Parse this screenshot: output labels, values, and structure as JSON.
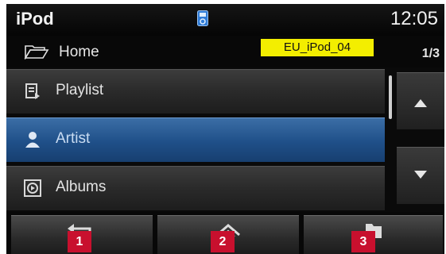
{
  "status": {
    "app_title": "iPod",
    "clock": "12:05"
  },
  "crumb": {
    "label": "Home",
    "tag": "EU_iPod_04",
    "page": "1/3"
  },
  "list": {
    "items": [
      {
        "label": "Playlist",
        "icon": "playlist-icon",
        "selected": false
      },
      {
        "label": "Artist",
        "icon": "artist-icon",
        "selected": true
      },
      {
        "label": "Albums",
        "icon": "album-icon",
        "selected": false
      }
    ]
  },
  "scroll": {
    "up": "scroll-up-icon",
    "down": "scroll-down-icon"
  },
  "bottom": {
    "buttons": [
      {
        "icon": "back-icon",
        "number": "1"
      },
      {
        "icon": "home-icon",
        "number": "2"
      },
      {
        "icon": "folder-icon",
        "number": "3"
      }
    ]
  },
  "colors": {
    "selected_row": "#1f4f88",
    "tag": "#f3ee00",
    "badge": "#c8102e"
  }
}
